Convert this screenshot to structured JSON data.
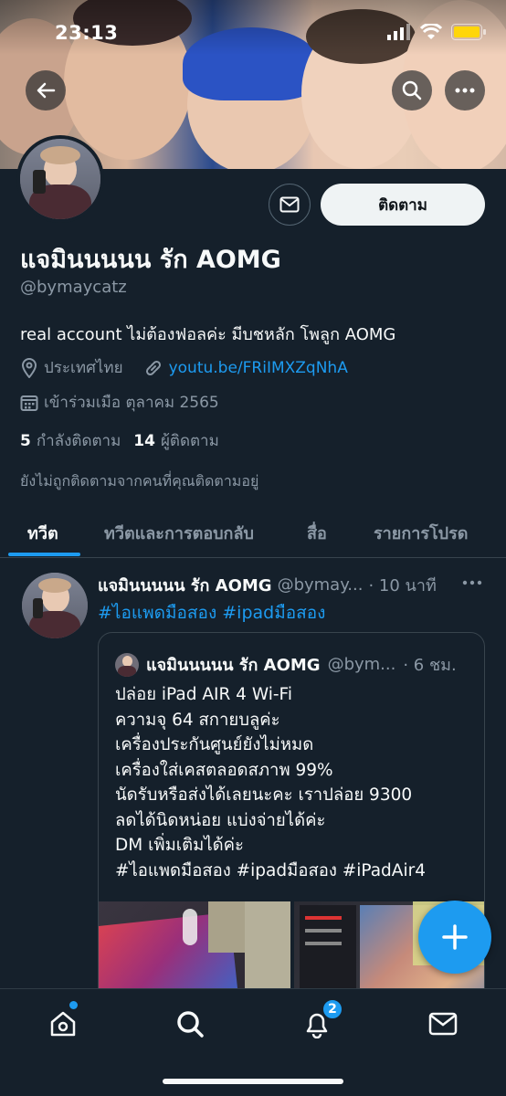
{
  "status_bar": {
    "time": "23:13"
  },
  "profile": {
    "display_name": "แจมินนนนน รัก AOMG",
    "handle": "@bymaycatz",
    "bio": "real account ไม่ต้องฟอลค่ะ มีบชหลัก โพลูก AOMG",
    "location": "ประเทศไทย",
    "link": "youtu.be/FRiIMXZqNhA",
    "joined": "เข้าร่วมเมือ ตุลาคม 2565",
    "following_count": "5",
    "following_label": "กำลังติดตาม",
    "followers_count": "14",
    "followers_label": "ผู้ติดตาม",
    "not_followed_text": "ยังไม่ถูกติดตามจากคนที่คุณติดตามอยู่",
    "follow_button": "ติดตาม"
  },
  "tabs": [
    {
      "label": "ทวีต",
      "active": true
    },
    {
      "label": "ทวีตและการตอบกลับ",
      "active": false
    },
    {
      "label": "สื่อ",
      "active": false
    },
    {
      "label": "รายการโปรด",
      "active": false
    }
  ],
  "tweet": {
    "name": "แจมินนนนน รัก AOMG",
    "handle": "@bymay...",
    "time": "· 10 นาที",
    "text": "#ไอแพดมือสอง #ipadมือสอง",
    "quote": {
      "name": "แจมินนนนน รัก AOMG",
      "handle": "@bym...",
      "time": "· 6 ชม.",
      "lines": [
        "ปล่อย iPad  AIR 4  Wi-Fi",
        "ความจุ 64 สกายบลูค่ะ",
        "เครื่องประกันศูนย์ยังไม่หมด",
        "เครื่องใส่เคสตลอดสภาพ 99%",
        "นัดรับหรือส่งได้เลยนะคะ เราปล่อย 9300",
        "ลดได้นิดหน่อย แบ่งจ่ายได้ค่ะ",
        "DM เพิ่มเติมได้ค่ะ",
        "#ไอแพดมือสอง #ipadมือสอง #iPadAir4"
      ]
    }
  },
  "nav": {
    "notifications_badge": "2"
  },
  "colors": {
    "background": "#15202b",
    "accent": "#1d9bf0",
    "muted": "#8b98a5"
  },
  "icons": [
    "back-arrow-icon",
    "search-icon",
    "more-icon",
    "mail-icon",
    "location-icon",
    "link-icon",
    "calendar-icon",
    "compose-icon",
    "home-icon",
    "bell-icon"
  ]
}
